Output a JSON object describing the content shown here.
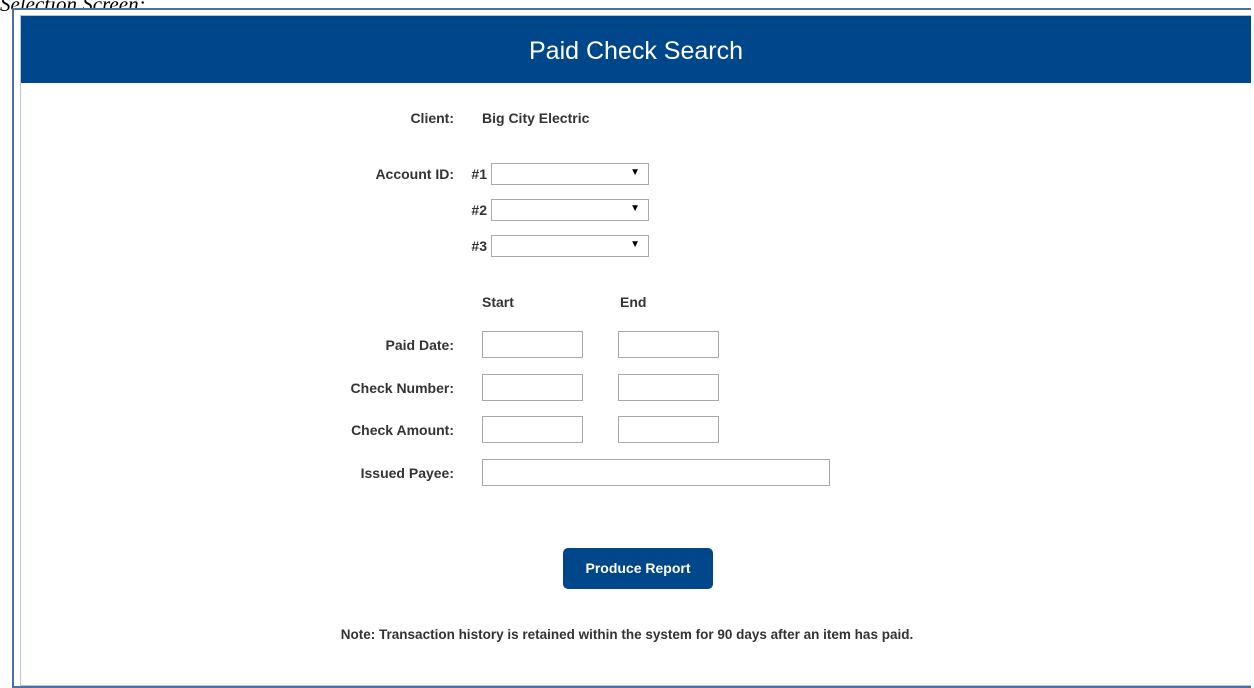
{
  "caption": "Selection Screen:",
  "header": {
    "title": "Paid Check Search"
  },
  "client": {
    "label": "Client:",
    "value": "Big City Electric"
  },
  "account": {
    "label": "Account ID:",
    "slots": [
      {
        "label": "#1",
        "value": ""
      },
      {
        "label": "#2",
        "value": ""
      },
      {
        "label": "#3",
        "value": ""
      }
    ]
  },
  "columns": {
    "start": "Start",
    "end": "End"
  },
  "fields": {
    "paid_date": "Paid Date:",
    "check_number": "Check Number:",
    "check_amount": "Check Amount:",
    "issued_payee": "Issued Payee:"
  },
  "buttons": {
    "produce_report": "Produce Report"
  },
  "note": "Note: Transaction history is retained within the system for 90 days after an item has paid.",
  "colors": {
    "primary": "#00468b",
    "border": "#4d6fa3"
  }
}
